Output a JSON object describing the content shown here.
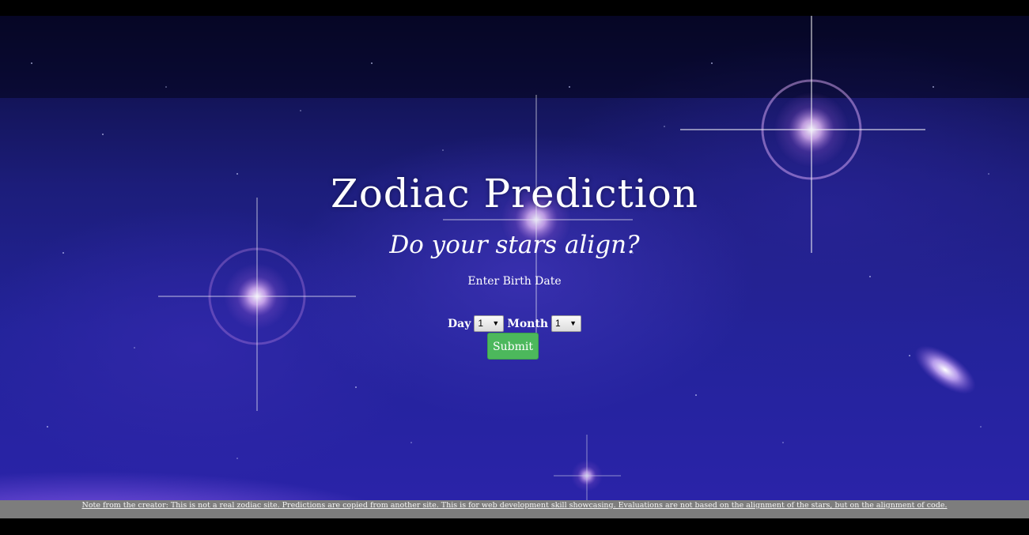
{
  "header": {
    "title": "Zodiac Prediction",
    "subtitle": "Do your stars align?"
  },
  "form": {
    "prompt": "Enter Birth Date",
    "day_label": "Day",
    "day_value": "1",
    "month_label": "Month",
    "month_value": "1",
    "submit_label": "Submit"
  },
  "footer": {
    "note": "Note from the creator: This is not a real zodiac site. Predictions are copied from another site. This is for web development skill showcasing. Evaluations are not based on the alignment of the stars, but on the alignment of code."
  },
  "colors": {
    "submit_bg": "#4cb85c",
    "footer_bg": "#7d7d7d",
    "sky": "#23239a"
  },
  "icons": {
    "select_arrow": "chevron-down-icon"
  }
}
